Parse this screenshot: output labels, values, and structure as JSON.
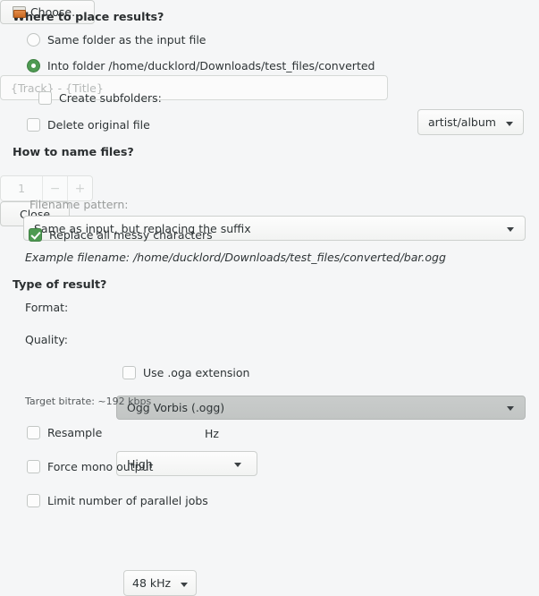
{
  "sections": {
    "where": {
      "heading": "Where to place results?",
      "same_folder_label": "Same folder as the input file",
      "same_folder_checked": false,
      "into_folder_label": "Into folder /home/ducklord/Downloads/test_files/converted",
      "into_folder_checked": true,
      "choose_button": "Choose...",
      "choose_icon": "folder-icon",
      "create_subfolders_label": "Create subfolders:",
      "create_subfolders_checked": false,
      "subfolders_pattern": "artist/album",
      "delete_original_label": "Delete original file",
      "delete_original_checked": false
    },
    "naming": {
      "heading": "How to name files?",
      "mode": "Same as input, but replacing the suffix",
      "pattern_label": "Filename pattern:",
      "pattern_placeholder": "{Track} - {Title}",
      "pattern_value": "",
      "replace_messy_label": "Replace all messy characters",
      "replace_messy_checked": true,
      "example_prefix": "Example filename:",
      "example_path": "/home/ducklord/Downloads/test_files/converted/bar.ogg"
    },
    "result": {
      "heading": "Type of result?",
      "format_label": "Format:",
      "format_value": "Ogg Vorbis (.ogg)",
      "quality_label": "Quality:",
      "quality_value": "High",
      "use_oga_label": "Use .oga extension",
      "use_oga_checked": false,
      "target_bitrate": "Target bitrate: ~192 kbps",
      "resample_label": "Resample",
      "resample_checked": false,
      "resample_value": "48 kHz",
      "resample_unit": "Hz",
      "force_mono_label": "Force mono output",
      "force_mono_checked": false,
      "limit_jobs_label": "Limit number of parallel jobs",
      "limit_jobs_checked": false,
      "jobs_value": "1",
      "jobs_decrement": "−",
      "jobs_increment": "+"
    }
  },
  "footer": {
    "close_button": "Close"
  },
  "colors": {
    "accent_green": "#4e9a52",
    "window_bg": "#f5f6f7",
    "text": "#2e3436",
    "disabled_text": "#989b9a"
  }
}
